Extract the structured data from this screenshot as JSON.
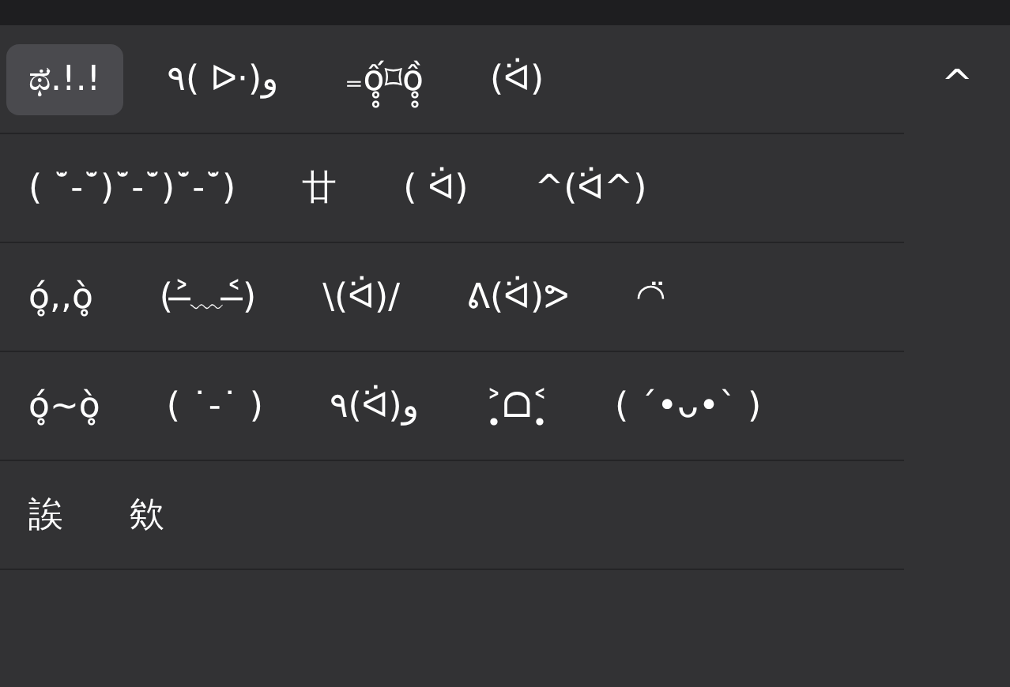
{
  "collapse_button": {
    "glyph": "^"
  },
  "rows": [
    {
      "candidates": [
        {
          "text": "ಥ̈.!.!",
          "selected": true
        },
        {
          "text": "٩(  ᐅ·)و",
          "selected": false
        },
        {
          "text": "₌ố̥̥⌑ồ̥̥",
          "selected": false
        },
        {
          "text": "(ᐛ)",
          "selected": false
        }
      ]
    },
    {
      "candidates": [
        {
          "text": "( ˙̆-˙̆)˙̆-˙̆)˙̆-˙̆)",
          "selected": false
        },
        {
          "text": "廿",
          "selected": false
        },
        {
          "text": "(  ᐛ)",
          "selected": false
        },
        {
          "text": "^(ᐛ^)",
          "selected": false
        }
      ]
    },
    {
      "candidates": [
        {
          "text": "ó̥,,ò̥",
          "selected": false
        },
        {
          "text": "(˃̶﹏˂̶)",
          "selected": false
        },
        {
          "text": "\\(ᐛ)/",
          "selected": false
        },
        {
          "text": "ᕕ(ᐛ)ᕗ",
          "selected": false
        },
        {
          "text": "◠̈",
          "selected": false
        }
      ]
    },
    {
      "candidates": [
        {
          "text": "ó̥~ò̥",
          "selected": false
        },
        {
          "text": "( ˙-˙ )",
          "selected": false
        },
        {
          "text": "٩(ᐛ)و",
          "selected": false
        },
        {
          "text": "˃̣̥ᗝ˂̣̥",
          "selected": false
        },
        {
          "text": "( ´•ᴗ•` )",
          "selected": false
        }
      ]
    },
    {
      "candidates": [
        {
          "text": "誒",
          "selected": false
        },
        {
          "text": "欸",
          "selected": false
        }
      ]
    }
  ]
}
